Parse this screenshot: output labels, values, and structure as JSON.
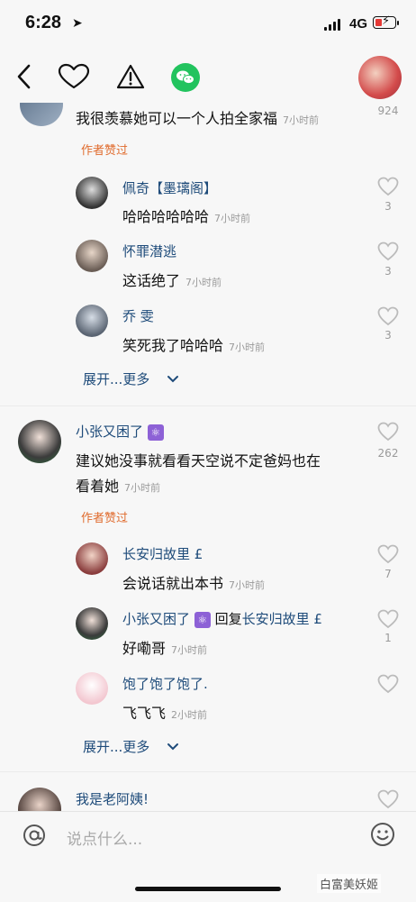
{
  "status_bar": {
    "time": "6:28",
    "network": "4G"
  },
  "top_bar": {
    "back_icon": "chevron-left-icon",
    "like_icon": "heart-icon",
    "report_icon": "warning-icon",
    "share_icon": "wechat-icon"
  },
  "colors": {
    "link": "#1e4b7a",
    "badge": "#e06b2d",
    "wechat": "#22c35e",
    "muted": "#9a9a9a"
  },
  "comments": [
    {
      "text": "我很羡慕她可以一个人拍全家福",
      "time": "7小时前",
      "likes": "924",
      "author_badge": "作者赞过",
      "replies": [
        {
          "name": "佩奇【墨璃阁】",
          "text": "哈哈哈哈哈哈",
          "time": "7小时前",
          "likes": "3"
        },
        {
          "name": "怀罪潜逃",
          "text": "这话绝了",
          "time": "7小时前",
          "likes": "3"
        },
        {
          "name": "乔 雯",
          "text": "笑死我了哈哈哈",
          "time": "7小时前",
          "likes": "3"
        }
      ],
      "expand": "展开...更多"
    },
    {
      "name": "小张又困了",
      "tag": "⚛",
      "text_line1": "建议她没事就看看天空说不定爸妈也在",
      "text_line2": "看着她",
      "time": "7小时前",
      "likes": "262",
      "author_badge": "作者赞过",
      "replies": [
        {
          "name": "长安归故里 £",
          "text": "会说话就出本书",
          "time": "7小时前",
          "likes": "7"
        },
        {
          "name": "小张又困了",
          "reply_label": "回复",
          "reply_to": "长安归故里 £",
          "text": "好嘞哥",
          "time": "7小时前",
          "likes": "1"
        },
        {
          "name": "饱了饱了饱了.",
          "text": "飞飞飞",
          "time": "2小时前",
          "likes": ""
        }
      ],
      "expand": "展开...更多"
    },
    {
      "name": "我是老阿姨!"
    }
  ],
  "input": {
    "placeholder": "说点什么...",
    "at_icon": "at-icon",
    "emoji_icon": "emoji-icon"
  },
  "watermark": "白富美妖姬"
}
